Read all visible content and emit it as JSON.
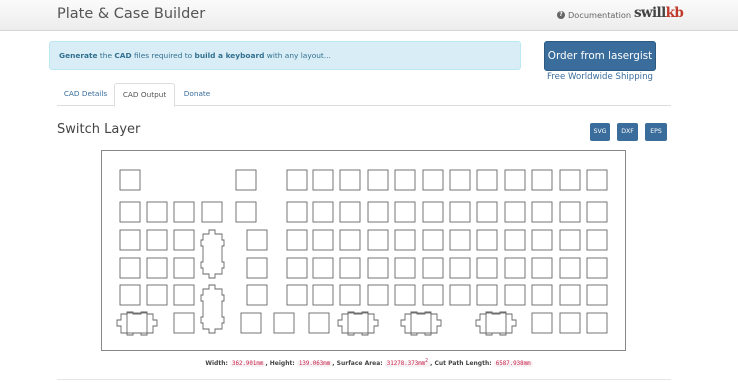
{
  "navbar": {
    "brand": "Plate & Case Builder",
    "documentation_label": "Documentation",
    "logo_prefix": "swill",
    "logo_suffix": "kb"
  },
  "alert": {
    "part1": "Generate",
    "part2": " the ",
    "part3": "CAD",
    "part4": " files required to ",
    "part5": "build a keyboard",
    "part6": " with any layout..."
  },
  "order": {
    "button_label": "Order from lasergist",
    "shipping_text": "Free Worldwide Shipping"
  },
  "tabs": [
    {
      "label": "CAD Details",
      "active": false
    },
    {
      "label": "CAD Output",
      "active": true
    },
    {
      "label": "Donate",
      "active": false
    }
  ],
  "section": {
    "title": "Switch Layer",
    "export_buttons": [
      "SVG",
      "DXF",
      "EPS"
    ]
  },
  "stats": {
    "width_label": "Width:",
    "width_value": "362.901mm",
    "height_label": "Height:",
    "height_value": "139.063mm",
    "area_label": "Surface Area:",
    "area_value": "31278.373mm",
    "area_sup": "2",
    "cut_label": "Cut Path Length:",
    "cut_value": "6587.938mm"
  },
  "colors": {
    "link_blue": "#3a6d9c",
    "alert_bg": "#d9edf7",
    "alert_text": "#31708f",
    "code_text": "#c7254e"
  }
}
